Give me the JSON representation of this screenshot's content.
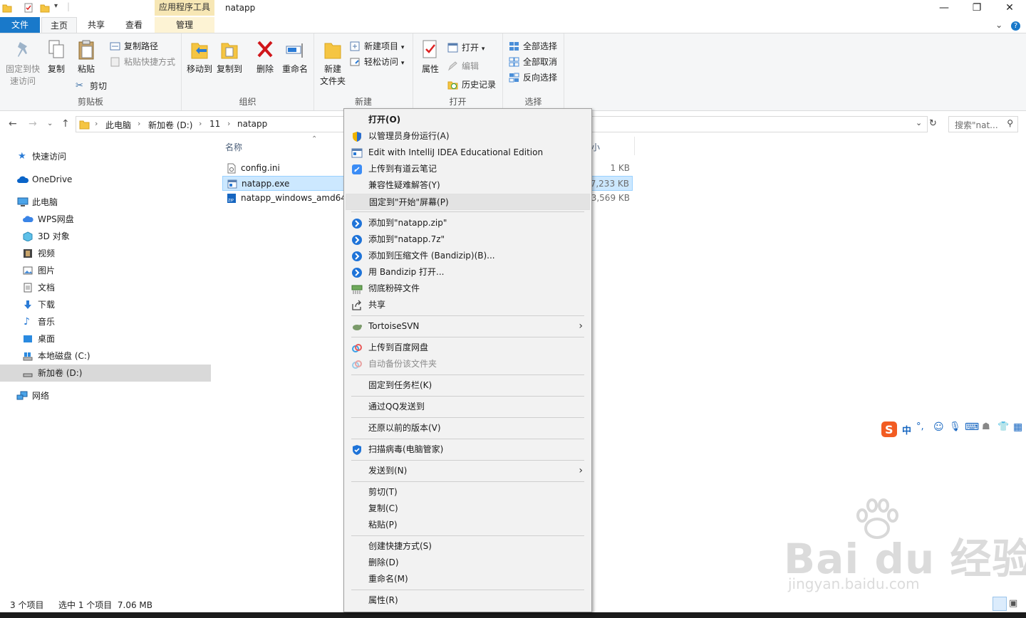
{
  "window": {
    "title": "natapp",
    "tool_tab_header": "应用程序工具"
  },
  "tabs": {
    "file": "文件",
    "home": "主页",
    "share": "共享",
    "view": "查看",
    "manage": "管理"
  },
  "ribbon": {
    "clipboard": {
      "label": "剪贴板",
      "pin": "固定到快\n速访问",
      "pin_l1": "固定到快",
      "pin_l2": "速访问",
      "copy": "复制",
      "paste": "粘贴",
      "copy_path": "复制路径",
      "paste_shortcut": "粘贴快捷方式",
      "cut": "剪切"
    },
    "organize": {
      "label": "组织",
      "move_to": "移动到",
      "copy_to": "复制到",
      "delete": "删除",
      "rename": "重命名"
    },
    "new": {
      "label": "新建",
      "new_folder_l1": "新建",
      "new_folder_l2": "文件夹",
      "new_item": "新建项目",
      "easy_access": "轻松访问"
    },
    "open": {
      "label": "打开",
      "properties": "属性",
      "open": "打开",
      "edit": "编辑",
      "history": "历史记录"
    },
    "select": {
      "label": "选择",
      "select_all": "全部选择",
      "select_none": "全部取消",
      "invert": "反向选择"
    }
  },
  "address": {
    "crumbs": [
      "此电脑",
      "新加卷 (D:)",
      "11",
      "natapp"
    ],
    "search_placeholder": "搜索\"nat..."
  },
  "nav": {
    "quick_access": "快速访问",
    "onedrive": "OneDrive",
    "this_pc": "此电脑",
    "wps": "WPS网盘",
    "objects3d": "3D 对象",
    "videos": "视频",
    "pictures": "图片",
    "documents": "文档",
    "downloads": "下载",
    "music": "音乐",
    "desktop": "桌面",
    "local_c": "本地磁盘 (C:)",
    "vol_d": "新加卷 (D:)",
    "network": "网络"
  },
  "filelist": {
    "col_name": "名称",
    "col_size_partial": "小",
    "files": [
      {
        "name": "config.ini",
        "size": "1 KB"
      },
      {
        "name": "natapp.exe",
        "size": "7,233 KB"
      },
      {
        "name": "natapp_windows_amd64_",
        "size": "3,569 KB"
      }
    ]
  },
  "status": {
    "count": "3 个项目",
    "selected": "选中 1 个项目  7.06 MB"
  },
  "context_menu": {
    "open": "打开(O)",
    "run_as_admin": "以管理员身份运行(A)",
    "intellij": "Edit with IntelliJ IDEA Educational Edition",
    "youdao": "上传到有道云笔记",
    "compat": "兼容性疑难解答(Y)",
    "pin_start": "固定到\"开始\"屏幕(P)",
    "add_zip": "添加到\"natapp.zip\"",
    "add_7z": "添加到\"natapp.7z\"",
    "add_bandizip": "添加到压缩文件 (Bandizip)(B)...",
    "open_bandizip": "用 Bandizip 打开...",
    "shred": "彻底粉碎文件",
    "share": "共享",
    "tortoisesvn": "TortoiseSVN",
    "baidu_upload": "上传到百度网盘",
    "baidu_backup": "自动备份该文件夹",
    "pin_taskbar": "固定到任务栏(K)",
    "send_qq": "通过QQ发送到",
    "restore_prev": "还原以前的版本(V)",
    "scan_virus": "扫描病毒(电脑管家)",
    "send_to": "发送到(N)",
    "cut": "剪切(T)",
    "copy": "复制(C)",
    "paste": "粘贴(P)",
    "create_shortcut": "创建快捷方式(S)",
    "delete": "删除(D)",
    "rename": "重命名(M)",
    "properties": "属性(R)"
  },
  "ime": {
    "mode": "中"
  },
  "watermark": {
    "main": "Bai du 经验",
    "sub": "jingyan.baidu.com"
  },
  "colors": {
    "file_tab": "#1979ca",
    "selection": "#cce8ff",
    "manage_tab": "#f7e7b5",
    "menu_bg": "#f2f2f2"
  }
}
